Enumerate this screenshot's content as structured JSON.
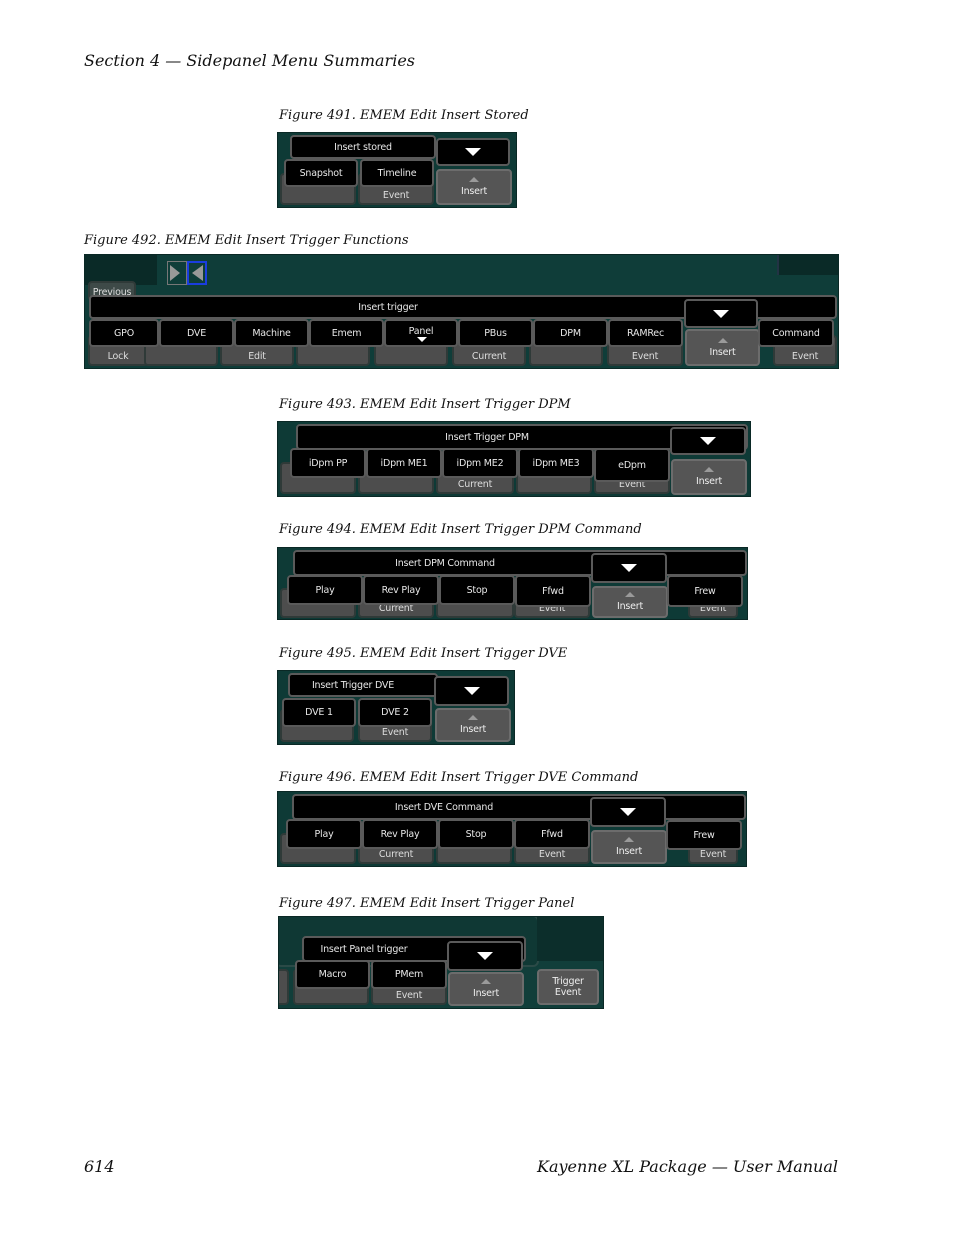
{
  "page": {
    "header": "Section 4 — Sidepanel Menu Summaries",
    "page_number": "614",
    "footer_title": "Kayenne XL Package — User Manual"
  },
  "figures": [
    {
      "caption": "Figure 491.  EMEM Edit Insert Stored",
      "title": "Insert stored",
      "buttons": [
        "Snapshot",
        "Timeline"
      ],
      "under": [
        "",
        "Event"
      ],
      "insert": "Insert"
    },
    {
      "caption": "Figure 492.  EMEM Edit Insert Trigger Functions",
      "title": "Insert trigger",
      "previous": "Previous",
      "buttons": [
        "GPO",
        "DVE",
        "Machine",
        "Emem",
        "Panel",
        "PBus",
        "DPM",
        "RAMRec",
        "Command"
      ],
      "under": [
        "Lock",
        "",
        "Edit",
        "",
        "",
        "Current",
        "",
        "Event",
        "Event"
      ],
      "insert": "Insert"
    },
    {
      "caption": "Figure 493.  EMEM Edit Insert Trigger DPM",
      "title": "Insert Trigger DPM",
      "buttons": [
        "iDpm PP",
        "iDpm ME1",
        "iDpm ME2",
        "iDpm ME3",
        "eDpm"
      ],
      "under": [
        "",
        "",
        "Current",
        "",
        "Event"
      ],
      "insert": "Insert"
    },
    {
      "caption": "Figure 494.  EMEM Edit Insert Trigger DPM Command",
      "title": "Insert DPM Command",
      "buttons": [
        "Play",
        "Rev Play",
        "Stop",
        "Ffwd",
        "Frew"
      ],
      "under": [
        "",
        "Current",
        "",
        "Event",
        "Event"
      ],
      "insert": "Insert"
    },
    {
      "caption": "Figure 495.  EMEM Edit Insert Trigger DVE",
      "title": "Insert Trigger DVE",
      "buttons": [
        "DVE 1",
        "DVE 2"
      ],
      "under": [
        "",
        "Event"
      ],
      "insert": "Insert"
    },
    {
      "caption": "Figure 496.  EMEM Edit Insert Trigger DVE Command",
      "title": "Insert DVE Command",
      "buttons": [
        "Play",
        "Rev Play",
        "Stop",
        "Ffwd",
        "Frew"
      ],
      "under": [
        "",
        "Current",
        "",
        "Event",
        "Event"
      ],
      "insert": "Insert"
    },
    {
      "caption": "Figure 497.  EMEM Edit Insert Trigger Panel",
      "title": "Insert Panel trigger",
      "buttons": [
        "Macro",
        "PMem"
      ],
      "under": [
        "",
        "Event"
      ],
      "insert": "Insert",
      "trigger_event": "Trigger Event"
    }
  ]
}
